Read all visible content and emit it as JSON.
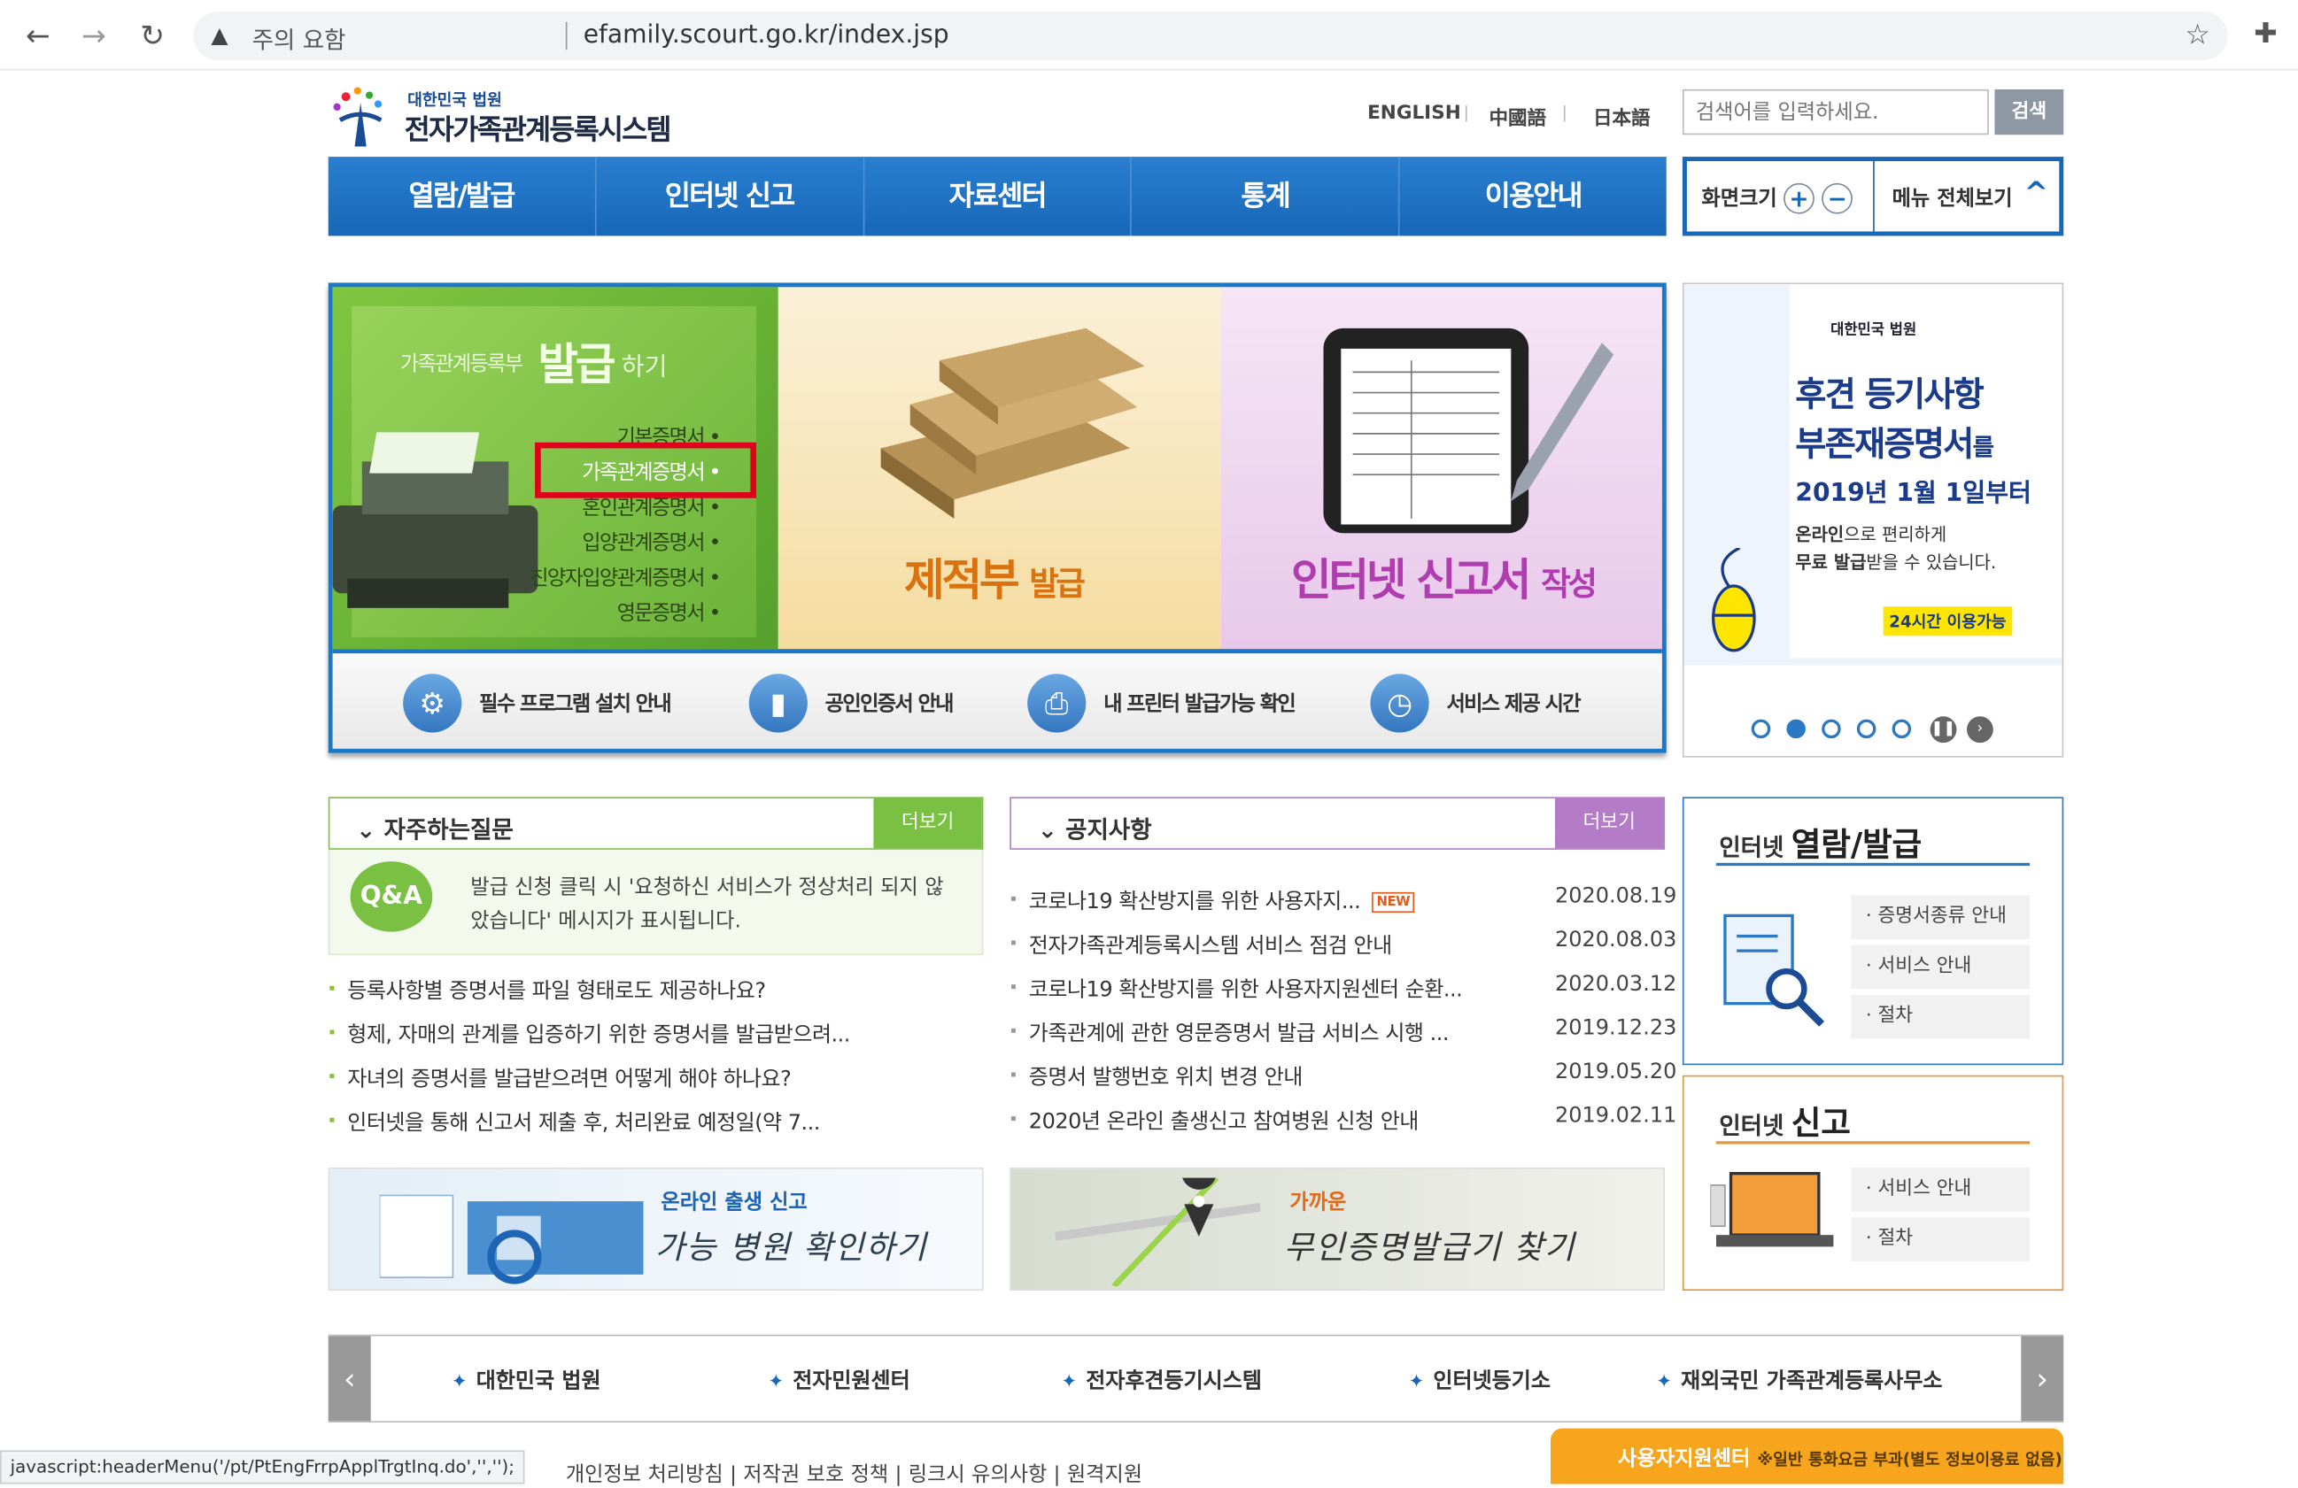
{
  "browser": {
    "warning": "주의 요함",
    "url": "efamily.scourt.go.kr/index.jsp"
  },
  "header": {
    "logo_small": "대한민국 법원",
    "logo_big": "전자가족관계등록시스템",
    "languages": [
      "ENGLISH",
      "中國語",
      "日本語"
    ],
    "search_placeholder": "검색어를 입력하세요.",
    "search_button": "검색"
  },
  "gnb": [
    "열람/발급",
    "인터넷 신고",
    "자료센터",
    "통계",
    "이용안내"
  ],
  "util": {
    "zoom_label": "화면크기",
    "zoom_in": "+",
    "zoom_out": "−",
    "all_menu": "메뉴 전체보기"
  },
  "visual": {
    "panel1_prefix": "가족관계등록부",
    "panel1_big": "발급",
    "panel1_suffix": "하기",
    "certificates": [
      "기본증명서 •",
      "가족관계증명서 •",
      "혼인관계증명서 •",
      "입양관계증명서 •",
      "친양자입양관계증명서 •",
      "영문증명서 •"
    ],
    "panel2_big": "제적부",
    "panel2_small": "발급",
    "panel3_big": "인터넷 신고서",
    "panel3_small": "작성",
    "bar": [
      "필수 프로그램 설치 안내",
      "공인인증서 안내",
      "내 프린터 발급가능 확인",
      "서비스 제공 시간"
    ]
  },
  "side_banner": {
    "court": "대한민국 법원",
    "line1": "후견 등기사항",
    "line2a": "부존재증명서",
    "line2b": "를",
    "line3": "2019년 1월 1일부터",
    "desc1a": "온라인",
    "desc1b": "으로 편리하게",
    "desc2a": "무료 발급",
    "desc2b": "받을 수 있습니다.",
    "badge": "24시간 이용가능"
  },
  "faq": {
    "title": "자주하는질문",
    "more": "더보기",
    "qa_icon": "Q&A",
    "featured": "발급 신청 클릭 시 '요청하신 서비스가 정상처리 되지 않았습니다' 메시지가 표시됩니다.",
    "items": [
      "등록사항별 증명서를 파일 형태로도 제공하나요?",
      "형제, 자매의 관계를 입증하기 위한 증명서를 발급받으려...",
      "자녀의 증명서를 발급받으려면 어떻게 해야 하나요?",
      "인터넷을 통해 신고서 제출 후, 처리완료 예정일(약 7..."
    ]
  },
  "notice": {
    "title": "공지사항",
    "more": "더보기",
    "new_badge": "NEW",
    "items": [
      {
        "title": "코로나19 확산방지를 위한 사용자지...",
        "date": "2020.08.19"
      },
      {
        "title": "전자가족관계등록시스템 서비스 점검 안내",
        "date": "2020.08.03"
      },
      {
        "title": "코로나19 확산방지를 위한 사용자지원센터 순환...",
        "date": "2020.03.12"
      },
      {
        "title": "가족관계에 관한 영문증명서 발급 서비스 시행 ...",
        "date": "2019.12.23"
      },
      {
        "title": "증명서 발행번호 위치 변경 안내",
        "date": "2019.05.20"
      },
      {
        "title": "2020년 온라인 출생신고 참여병원 신청 안내",
        "date": "2019.02.11"
      }
    ]
  },
  "rbox1": {
    "small": "인터넷",
    "big": "열람/발급",
    "items": [
      "· 증명서종류 안내",
      "· 서비스 안내",
      "· 절차"
    ]
  },
  "rbox2": {
    "small": "인터넷",
    "big": "신고",
    "items": [
      "· 서비스 안내",
      "· 절차"
    ]
  },
  "banner1": {
    "small": "온라인 출생 신고",
    "big": "가능 병원 확인하기"
  },
  "banner2": {
    "small": "가까운",
    "big": "무인증명발급기 찾기"
  },
  "family_sites": [
    "대한민국 법원",
    "전자민원센터",
    "전자후견등기시스템",
    "인터넷등기소",
    "재외국민 가족관계등록사무소"
  ],
  "footer": {
    "links": "개인정보 처리방침 | 저작권 보호 정책 | 링크시 유의사항 | 원격지원",
    "support_title": "사용자지원센터",
    "support_note": "※일반 통화요금 부과(별도 정보이용료 없음)"
  },
  "status_bar": "javascript:headerMenu('/pt/PtEngFrrpApplTrgtInq.do','','');",
  "colors": {
    "primary_blue": "#1867b8",
    "faq_green": "#7ac143",
    "notice_purple": "#b47cc6",
    "highlight_red": "#e0001b",
    "support_orange": "#f7a51c"
  }
}
